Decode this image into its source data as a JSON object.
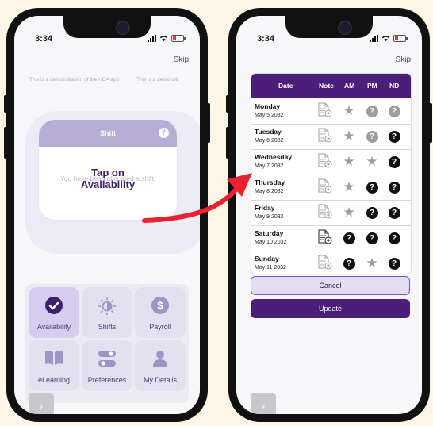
{
  "left_phone": {
    "status": {
      "time": "3:34"
    },
    "skip_label": "Skip",
    "marquee": [
      "This is a demonstration of the HCA app",
      "This is a demonsti"
    ],
    "shift_card": {
      "title": "Shift",
      "help": "?",
      "message": "You have been allocated a shift."
    },
    "overlay": {
      "line1": "Tap on",
      "line2": "Availability"
    },
    "menu": [
      {
        "label": "Availability",
        "icon": "check-circle-icon",
        "active": true
      },
      {
        "label": "Shifts",
        "icon": "sun-moon-icon",
        "active": false
      },
      {
        "label": "Payroll",
        "icon": "dollar-icon",
        "active": false
      },
      {
        "label": "eLearning",
        "icon": "book-icon",
        "active": false
      },
      {
        "label": "Preferences",
        "icon": "toggles-icon",
        "active": false
      },
      {
        "label": "My Details",
        "icon": "person-icon",
        "active": false
      }
    ],
    "next_label": "›"
  },
  "right_phone": {
    "status": {
      "time": "3:34"
    },
    "skip_label": "Skip",
    "table": {
      "headers": {
        "date": "Date",
        "note": "Note",
        "am": "AM",
        "pm": "PM",
        "nd": "ND"
      },
      "rows": [
        {
          "day": "Monday",
          "date": "May 5 2032",
          "note": "inactive",
          "am": "star",
          "pm": "question-grey",
          "nd": "question-grey"
        },
        {
          "day": "Tuesday",
          "date": "May 6 2032",
          "note": "inactive",
          "am": "star",
          "pm": "question-grey",
          "nd": "question"
        },
        {
          "day": "Wednesday",
          "date": "May 7 2032",
          "note": "inactive",
          "am": "star",
          "pm": "star",
          "nd": "question"
        },
        {
          "day": "Thursday",
          "date": "May 8 2032",
          "note": "inactive",
          "am": "star",
          "pm": "question",
          "nd": "question"
        },
        {
          "day": "Friday",
          "date": "May 9 2032",
          "note": "inactive",
          "am": "star",
          "pm": "question",
          "nd": "question"
        },
        {
          "day": "Saturday",
          "date": "May 10 2032",
          "note": "active",
          "am": "question",
          "pm": "question",
          "nd": "question"
        },
        {
          "day": "Sunday",
          "date": "May 11 2032",
          "note": "inactive",
          "am": "question",
          "pm": "star",
          "nd": "question"
        }
      ]
    },
    "cancel_label": "Cancel",
    "update_label": "Update",
    "next_label": "›"
  },
  "colors": {
    "primary": "#4a1e79",
    "accent_arrow": "#e8222e",
    "background": "#fdf6e6"
  }
}
